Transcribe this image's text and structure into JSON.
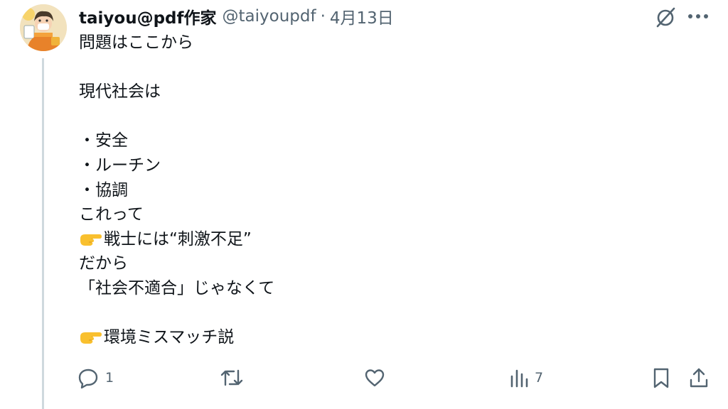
{
  "tweet": {
    "display_name": "taiyou@pdf作家",
    "handle": "@taiyoupdf",
    "separator": "·",
    "date": "4月13日",
    "body_lines": [
      "問題はここから",
      "",
      "現代社会は",
      "",
      "・安全",
      "・ルーチン",
      "・協調",
      "これって",
      "戦士には“刺激不足”",
      "だから",
      "「社会不適合」じゃなくて",
      "",
      "環境ミスマッチ説"
    ],
    "pointing_emoji_lines": [
      8,
      12
    ]
  },
  "actions": {
    "reply_count": "1",
    "retweet_count": "",
    "like_count": "",
    "views_count": "7"
  },
  "icons": {
    "grok": "grok-icon",
    "more": "more-horizontal-icon",
    "reply": "reply-icon",
    "retweet": "retweet-icon",
    "like": "heart-icon",
    "views": "views-chart-icon",
    "bookmark": "bookmark-icon",
    "share": "share-icon",
    "emoji": "pointing-hand-emoji"
  },
  "colors": {
    "text": "#0f1419",
    "muted": "#536471",
    "thread_line": "#cfd9de",
    "emoji": "#f9c02e"
  }
}
